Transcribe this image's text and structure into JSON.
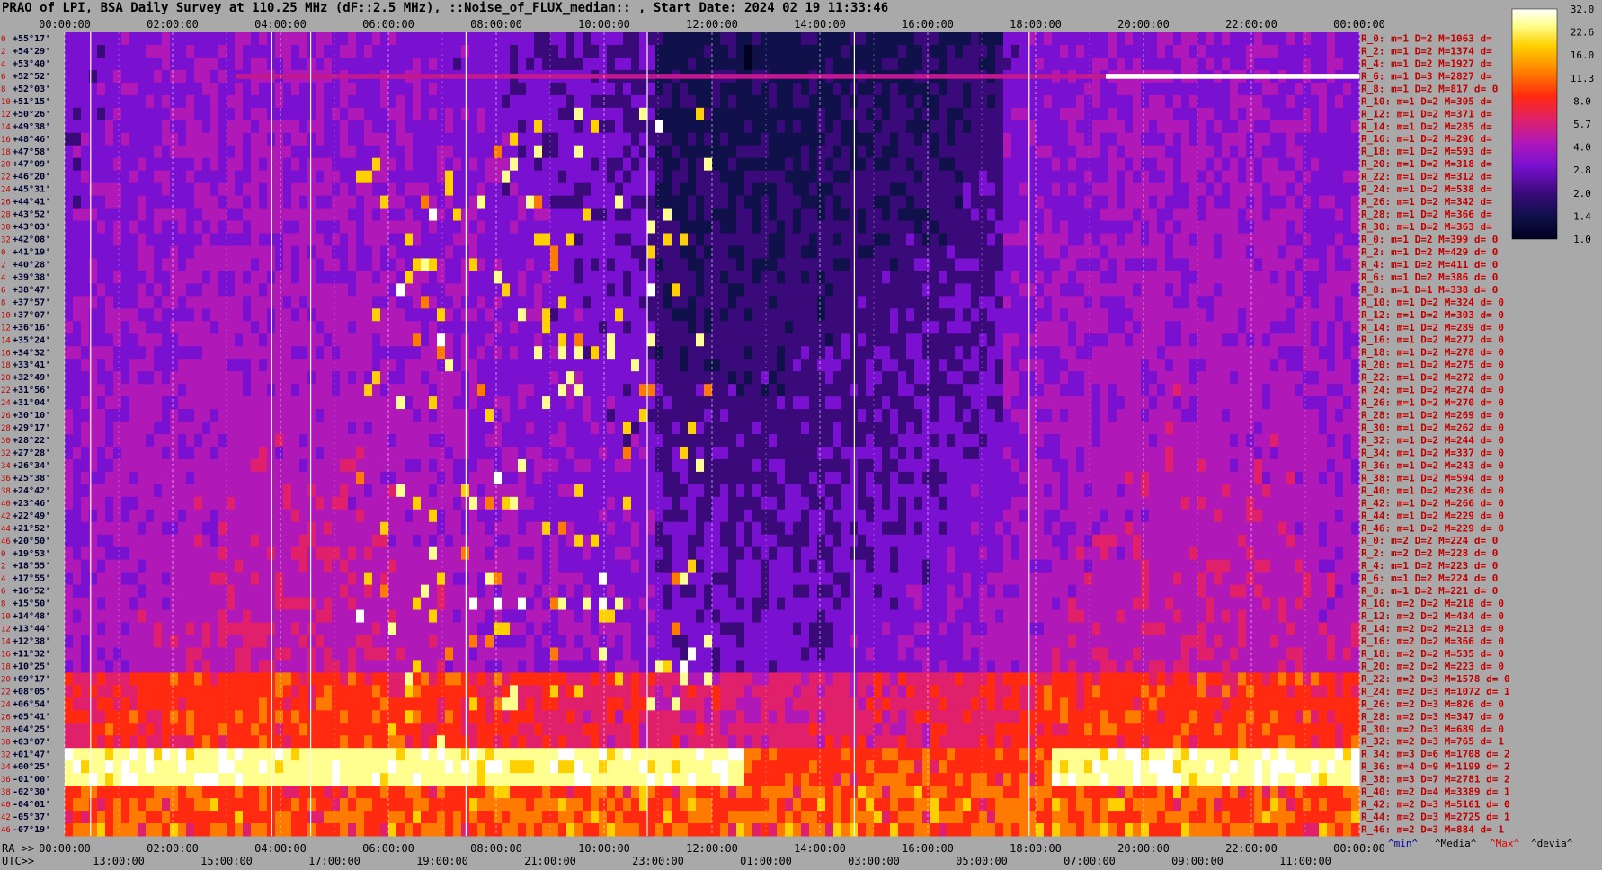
{
  "title": "PRAO of LPI, BSA Daily Survey at 110.25 MHz (dF::2.5 MHz), ::Noise_of_FLUX_median:: , Start Date: 2024 02 19 11:33:46",
  "chart_data": {
    "type": "heatmap",
    "ra_label": "RA >>",
    "utc_label": "UTC>>",
    "ra_ticks_top": [
      "00:00:00",
      "02:00:00",
      "04:00:00",
      "06:00:00",
      "08:00:00",
      "10:00:00",
      "12:00:00",
      "14:00:00",
      "16:00:00",
      "18:00:00",
      "20:00:00",
      "22:00:00",
      "00:00:00"
    ],
    "ra_ticks_bottom": [
      "00:00:00",
      "02:00:00",
      "04:00:00",
      "06:00:00",
      "08:00:00",
      "10:00:00",
      "12:00:00",
      "14:00:00",
      "16:00:00",
      "18:00:00",
      "20:00:00",
      "22:00:00",
      "00:00:00"
    ],
    "utc_ticks": [
      "13:00:00",
      "15:00:00",
      "17:00:00",
      "19:00:00",
      "21:00:00",
      "23:00:00",
      "01:00:00",
      "03:00:00",
      "05:00:00",
      "07:00:00",
      "09:00:00",
      "11:00:00"
    ],
    "declinations": [
      "+55°17'",
      "+54°29'",
      "+53°40'",
      "+52°52'",
      "+52°03'",
      "+51°15'",
      "+50°26'",
      "+49°38'",
      "+48°46'",
      "+47°58'",
      "+47°09'",
      "+46°20'",
      "+45°31'",
      "+44°41'",
      "+43°52'",
      "+43°03'",
      "+42°08'",
      "+41°19'",
      "+40°28'",
      "+39°38'",
      "+38°47'",
      "+37°57'",
      "+37°07'",
      "+36°16'",
      "+35°24'",
      "+34°32'",
      "+33°41'",
      "+32°49'",
      "+31°56'",
      "+31°04'",
      "+30°10'",
      "+29°17'",
      "+28°22'",
      "+27°28'",
      "+26°34'",
      "+25°38'",
      "+24°42'",
      "+23°46'",
      "+22°49'",
      "+21°52'",
      "+20°50'",
      "+19°53'",
      "+18°55'",
      "+17°55'",
      "+16°52'",
      "+15°50'",
      "+14°48'",
      "+13°44'",
      "+12°38'",
      "+11°32'",
      "+10°25'",
      "+09°17'",
      "+08°05'",
      "+06°54'",
      "+05°41'",
      "+04°25'",
      "+03°07'",
      "+01°47'",
      "+00°25'",
      "-01°00'",
      "-02°30'",
      "-04°01'",
      "-05°37'",
      "-07°19'"
    ],
    "row_index_labels": [
      "0",
      "2",
      "4",
      "6",
      "8",
      "10",
      "12",
      "14",
      "16",
      "18",
      "20",
      "22",
      "24",
      "26",
      "28",
      "30",
      "32",
      "0",
      "2",
      "4",
      "6",
      "8",
      "10",
      "12",
      "14",
      "16",
      "18",
      "20",
      "22",
      "24",
      "26",
      "28",
      "30",
      "32",
      "34",
      "36",
      "38",
      "40",
      "42",
      "44",
      "46",
      "0",
      "2",
      "4",
      "6",
      "8",
      "10",
      "12",
      "14",
      "16",
      "18",
      "20",
      "22",
      "24",
      "26",
      "28",
      "30",
      "32",
      "34",
      "36",
      "38",
      "40",
      "42",
      "46"
    ],
    "right_stats": [
      "R_0: m=1 D=2 M=1063 d=",
      "R_2: m=1 D=2 M=1374 d=",
      "R_4: m=1 D=2 M=1927 d=",
      "R_6: m=1 D=3 M=2827 d=",
      "R_8: m=1 D=2 M=817 d= 0",
      "R_10: m=1 D=2 M=305 d=",
      "R_12: m=1 D=2 M=371 d=",
      "R_14: m=1 D=2 M=285 d=",
      "R_16: m=1 D=2 M=296 d=",
      "R_18: m=1 D=2 M=593 d=",
      "R_20: m=1 D=2 M=318 d=",
      "R_22: m=1 D=2 M=312 d=",
      "R_24: m=1 D=2 M=538 d=",
      "R_26: m=1 D=2 M=342 d=",
      "R_28: m=1 D=2 M=366 d=",
      "R_30: m=1 D=2 M=363 d=",
      "R_0: m=1 D=2 M=399 d= 0",
      "R_2: m=1 D=2 M=429 d= 0",
      "R_4: m=1 D=2 M=411 d= 0",
      "R_6: m=1 D=2 M=386 d= 0",
      "R_8: m=1 D=1 M=338 d= 0",
      "R_10: m=1 D=2 M=324 d= 0",
      "R_12: m=1 D=2 M=303 d= 0",
      "R_14: m=1 D=2 M=289 d= 0",
      "R_16: m=1 D=2 M=277 d= 0",
      "R_18: m=1 D=2 M=278 d= 0",
      "R_20: m=1 D=2 M=275 d= 0",
      "R_22: m=1 D=2 M=272 d= 0",
      "R_24: m=1 D=2 M=274 d= 0",
      "R_26: m=1 D=2 M=270 d= 0",
      "R_28: m=1 D=2 M=269 d= 0",
      "R_30: m=1 D=2 M=262 d= 0",
      "R_32: m=1 D=2 M=244 d= 0",
      "R_34: m=1 D=2 M=337 d= 0",
      "R_36: m=1 D=2 M=243 d= 0",
      "R_38: m=1 D=2 M=594 d= 0",
      "R_40: m=1 D=2 M=236 d= 0",
      "R_42: m=1 D=2 M=266 d= 0",
      "R_44: m=1 D=2 M=229 d= 0",
      "R_46: m=1 D=2 M=229 d= 0",
      "R_0: m=2 D=2 M=224 d= 0",
      "R_2: m=2 D=2 M=228 d= 0",
      "R_4: m=1 D=2 M=223 d= 0",
      "R_6: m=1 D=2 M=224 d= 0",
      "R_8: m=1 D=2 M=221 d= 0",
      "R_10: m=2 D=2 M=218 d= 0",
      "R_12: m=2 D=2 M=434 d= 0",
      "R_14: m=2 D=2 M=213 d= 0",
      "R_16: m=2 D=2 M=366 d= 0",
      "R_18: m=2 D=2 M=535 d= 0",
      "R_20: m=2 D=2 M=223 d= 0",
      "R_22: m=2 D=3 M=1578 d= 0",
      "R_24: m=2 D=3 M=1072 d= 1",
      "R_26: m=2 D=3 M=826 d= 0",
      "R_28: m=2 D=3 M=347 d= 0",
      "R_30: m=2 D=3 M=689 d= 0",
      "R_32: m=2 D=3 M=765 d= 1",
      "R_34: m=3 D=6 M=1708 d= 2",
      "R_36: m=4 D=9 M=1199 d= 2",
      "R_38: m=3 D=7 M=2781 d= 2",
      "R_40: m=2 D=4 M=3389 d= 1",
      "R_42: m=2 D=3 M=5161 d= 0",
      "R_44: m=2 D=3 M=2725 d= 1",
      "R_46: m=2 D=3 M=884 d= 1"
    ],
    "legend_bottom": [
      "^min^",
      "^Media^",
      "^Max^",
      "^devia^"
    ],
    "colorbar_ticks": [
      "32.0",
      "22.6",
      "16.0",
      "11.3",
      "8.0",
      "5.7",
      "4.0",
      "2.8",
      "2.0",
      "1.4",
      "1.0"
    ],
    "colormap": [
      "#000020",
      "#10104a",
      "#3a0a7a",
      "#7a10d0",
      "#b018b8",
      "#e0206a",
      "#ff2a10",
      "#ff7a00",
      "#ffd000",
      "#ffff90",
      "#ffffff"
    ],
    "description_bands": {
      "bright_equatorial_band_dec": [
        "+01°47'",
        "-01°00'"
      ],
      "hot_rows": [
        "+52°52'"
      ]
    }
  }
}
